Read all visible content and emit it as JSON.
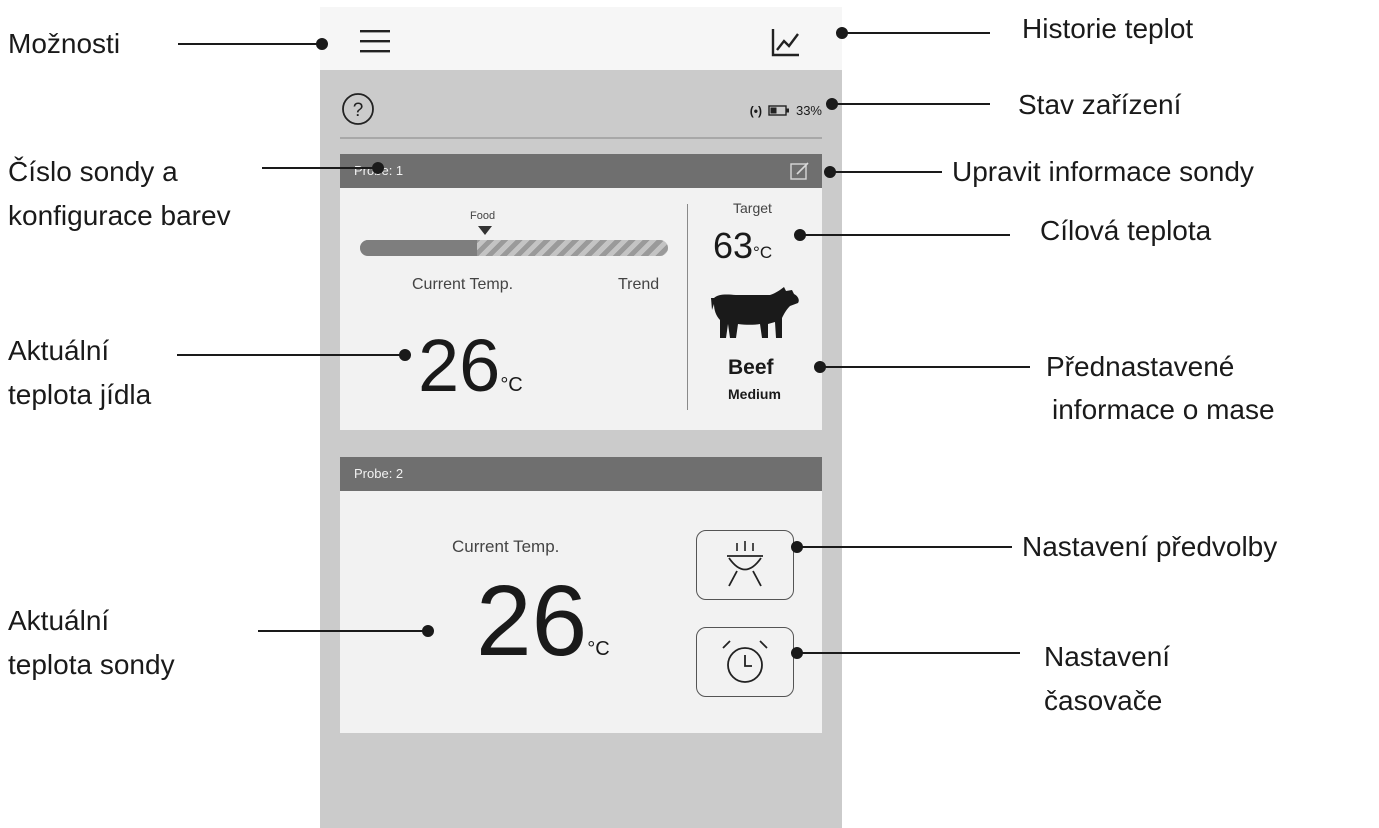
{
  "app": {
    "menu_icon": "hamburger-menu-icon",
    "history_icon": "chart-line-icon",
    "help_icon": "question-circle-icon",
    "status": {
      "wifi": "(•)",
      "battery_icon": "battery-icon",
      "battery_percent": "33%"
    }
  },
  "probe1": {
    "header": "Probe: 1",
    "edit_icon": "edit-icon",
    "food_label": "Food",
    "progress_fraction": 0.38,
    "current_label": "Current Temp.",
    "trend_label": "Trend",
    "current_temp": "26",
    "unit": "°C",
    "target_label": "Target",
    "target_temp": "63",
    "meat_icon": "cow-icon",
    "meat": "Beef",
    "doneness": "Medium"
  },
  "probe2": {
    "header": "Probe: 2",
    "current_label": "Current Temp.",
    "current_temp": "26",
    "unit": "°C",
    "preset_icon": "grill-icon",
    "timer_icon": "alarm-clock-icon"
  },
  "annotations": {
    "moznosti": "Možnosti",
    "historie": "Historie teplot",
    "stav": "Stav zařízení",
    "cislo_l1": "Číslo sondy a",
    "cislo_l2": "konfigurace barev",
    "upravit": "Upravit informace sondy",
    "cilova": "Cílová teplota",
    "aktualni_jidla_l1": "Aktuální",
    "aktualni_jidla_l2": "teplota jídla",
    "prednast_l1": "Přednastavené",
    "prednast_l2": "informace o mase",
    "predvolba": "Nastavení předvolby",
    "aktualni_sondy_l1": "Aktuální",
    "aktualni_sondy_l2": "teplota sondy",
    "casovac_l1": "Nastavení",
    "casovac_l2": "časovače"
  }
}
